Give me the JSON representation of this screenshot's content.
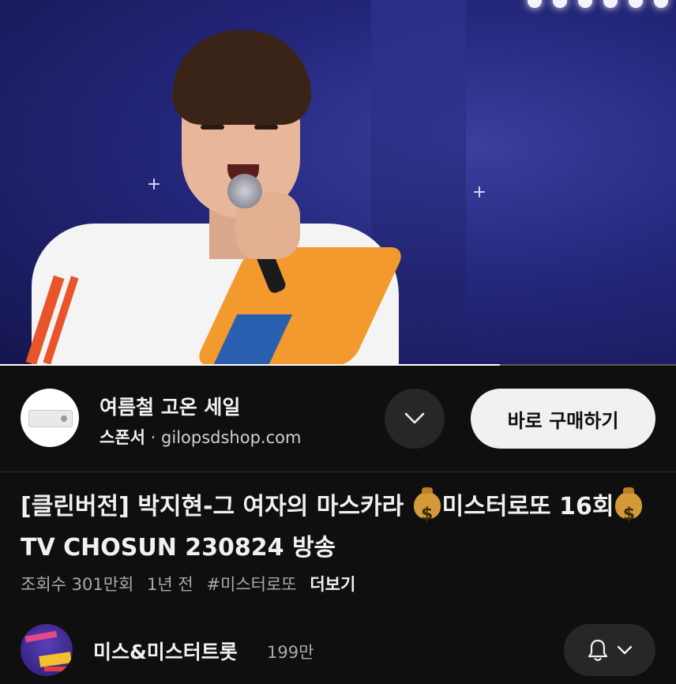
{
  "video": {
    "progress_fraction": 0.74
  },
  "sponsor": {
    "title": "여름철 고온 세일",
    "label": "스폰서",
    "separator": "·",
    "domain": "gilopsdshop.com",
    "cta_label": "바로 구매하기",
    "expand_icon": "chevron-down-icon"
  },
  "video_info": {
    "title_part1": "[클린버전] 박지현-그 여자의 마스카라 ",
    "title_part2": "미스터로또 16회",
    "title_part3": " TV CHOSUN 230824 방송",
    "title_emoji": "money-bag-icon",
    "views": "조회수 301만회",
    "age": "1년 전",
    "hashtag": "#미스터로또",
    "more_label": "더보기"
  },
  "channel": {
    "name": "미스&미스터트롯",
    "subscribers": "199만",
    "bell_icon": "bell-icon",
    "dropdown_icon": "chevron-down-icon"
  },
  "colors": {
    "background": "#0f0f0f",
    "surface": "#272727",
    "text_primary": "#f1f1f1",
    "text_secondary": "#aaaaaa",
    "cta_background": "#f1f1f1"
  }
}
